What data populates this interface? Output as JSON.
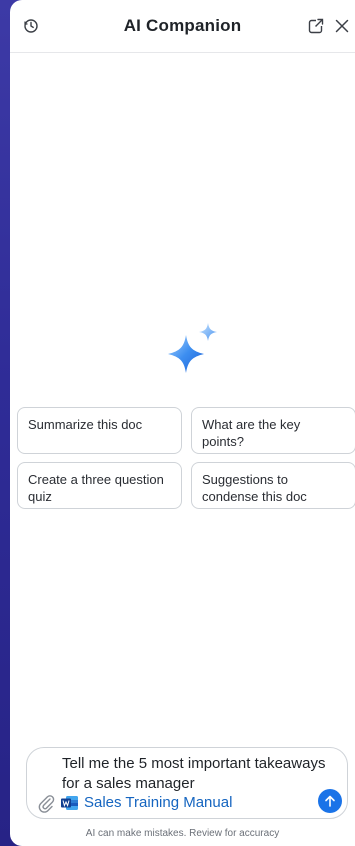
{
  "header": {
    "title": "AI Companion"
  },
  "suggestions": [
    {
      "label": "Summarize this doc"
    },
    {
      "label": "What are the key points?"
    },
    {
      "label": "Create a three question quiz"
    },
    {
      "label": "Suggestions to condense this doc"
    }
  ],
  "composer": {
    "prompt": "Tell me the 5 most important takeaways for a sales manager",
    "document_label": "Sales Training Manual"
  },
  "footer": {
    "disclaimer": "AI can make mistakes. Review for accuracy"
  },
  "icons": {
    "history": "history-icon",
    "popout": "popout-icon",
    "close": "close-icon",
    "sparkle": "sparkle-icon",
    "attach": "paperclip-icon",
    "word": "word-doc-icon",
    "send": "send-arrow-icon"
  },
  "colors": {
    "accent": "#1a73e8",
    "link": "#1565c0",
    "backdrop": "#2f2c97"
  }
}
